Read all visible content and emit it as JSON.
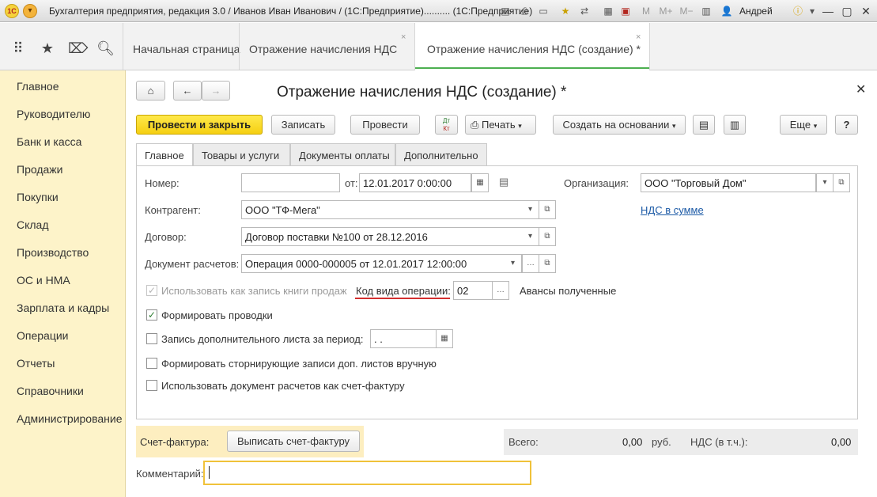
{
  "window": {
    "title": "Бухгалтерия предприятия, редакция 3.0 / Иванов Иван Иванович / (1С:Предприятие)..........  (1С:Предприятие)",
    "user": "Андрей",
    "logo": "1С"
  },
  "topbar": {
    "tabs": [
      {
        "label": "Начальная страница"
      },
      {
        "label": "Отражение начисления НДС",
        "close": "×"
      },
      {
        "label": "Отражение начисления НДС (создание) *",
        "close": "×"
      }
    ]
  },
  "sidebar": {
    "items": [
      {
        "label": "Главное"
      },
      {
        "label": "Руководителю"
      },
      {
        "label": "Банк и касса"
      },
      {
        "label": "Продажи"
      },
      {
        "label": "Покупки"
      },
      {
        "label": "Склад"
      },
      {
        "label": "Производство"
      },
      {
        "label": "ОС и НМА"
      },
      {
        "label": "Зарплата и кадры"
      },
      {
        "label": "Операции"
      },
      {
        "label": "Отчеты"
      },
      {
        "label": "Справочники"
      },
      {
        "label": "Администрирование"
      }
    ]
  },
  "form": {
    "title": "Отражение начисления НДС (создание) *",
    "toolbar": {
      "post_close": "Провести и закрыть",
      "save": "Записать",
      "post": "Провести",
      "print": "Печать",
      "create_based": "Создать на основании",
      "more": "Еще",
      "help": "?"
    },
    "tabs": [
      {
        "label": "Главное"
      },
      {
        "label": "Товары и услуги"
      },
      {
        "label": "Документы оплаты"
      },
      {
        "label": "Дополнительно"
      }
    ],
    "fields": {
      "number_label": "Номер:",
      "number_value": "",
      "date_label": "от:",
      "date_value": "12.01.2017  0:00:00",
      "org_label": "Организация:",
      "org_value": "ООО \"Торговый Дом\"",
      "vat_link": "НДС в сумме",
      "counterparty_label": "Контрагент:",
      "counterparty_value": "ООО \"ТФ-Мега\"",
      "contract_label": "Договор:",
      "contract_value": "Договор поставки №100 от 28.12.2016",
      "settlement_label": "Документ расчетов:",
      "settlement_value": "Операция 0000-000005 от 12.01.2017 12:00:00",
      "sales_book_label": "Использовать как запись книги продаж",
      "op_code_label": "Код вида операции:",
      "op_code_value": "02",
      "op_code_desc": "Авансы полученные",
      "postings_label": "Формировать проводки",
      "extra_sheet_label": "Запись дополнительного листа за период:",
      "extra_sheet_value": " .  .",
      "storno_label": "Формировать сторнирующие записи доп. листов вручную",
      "use_invoice_label": "Использовать документ расчетов как счет-фактуру"
    },
    "checks": {
      "sales_book": true,
      "postings": true,
      "extra_sheet": false,
      "storno": false,
      "use_invoice": false
    },
    "bottom": {
      "invoice_label": "Счет-фактура:",
      "invoice_button": "Выписать счет-фактуру",
      "total_label": "Всего:",
      "total_value": "0,00",
      "currency": "руб.",
      "vat_label": "НДС (в т.ч.):",
      "vat_value": "0,00",
      "comment_label": "Комментарий:",
      "comment_value": ""
    }
  },
  "colors": {
    "accent_yellow": "#f5cf12",
    "sidebar_bg": "#fdf3c9",
    "link_blue": "#1c5aa6",
    "active_tab_underline": "#4caf50",
    "annotation_red": "#d32f2f"
  }
}
